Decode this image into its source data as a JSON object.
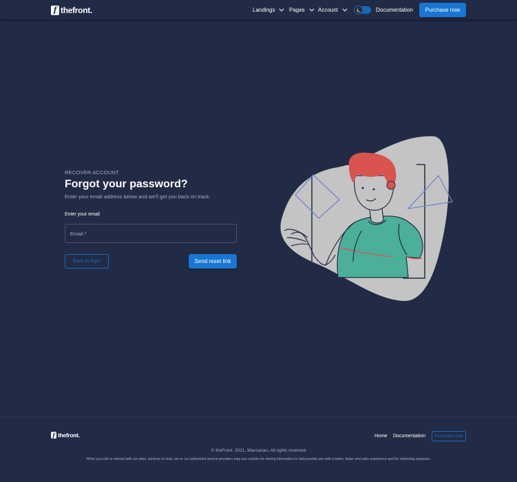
{
  "header": {
    "logo_text": "thefront.",
    "logo_glyph": "f",
    "nav": [
      {
        "label": "Landings"
      },
      {
        "label": "Pages"
      },
      {
        "label": "Account"
      }
    ],
    "theme_toggle_icon": "moon-icon",
    "documentation_label": "Documentation",
    "purchase_label": "Purchase now"
  },
  "form": {
    "overline": "RECOVER ACCOUNT",
    "title": "Forgot your password?",
    "subtitle": "Enter your email address below and we'll get you back on track.",
    "email_label": "Enter your email",
    "email_placeholder": "Email *",
    "email_value": "",
    "back_label": "Back to login",
    "submit_label": "Send reset link"
  },
  "footer": {
    "logo_text": "thefront.",
    "logo_glyph": "f",
    "links": [
      {
        "label": "Home"
      },
      {
        "label": "Documentation"
      }
    ],
    "purchase_label": "Purchase now",
    "copyright": "© theFront. 2021, Maccarian. All rights reserved",
    "legal": "When you visit or interact with our sites, services or tools, we or our authorised service providers may use cookies for storing information to help provide you with a better, faster and safer experience and for marketing purposes."
  },
  "colors": {
    "background": "#222b45",
    "primary": "#1976d2",
    "text_secondary": "#a6aec3",
    "illustration_blob": "#c4c4c4",
    "illustration_shirt": "#4caf9a",
    "illustration_hair": "#d9534f"
  }
}
